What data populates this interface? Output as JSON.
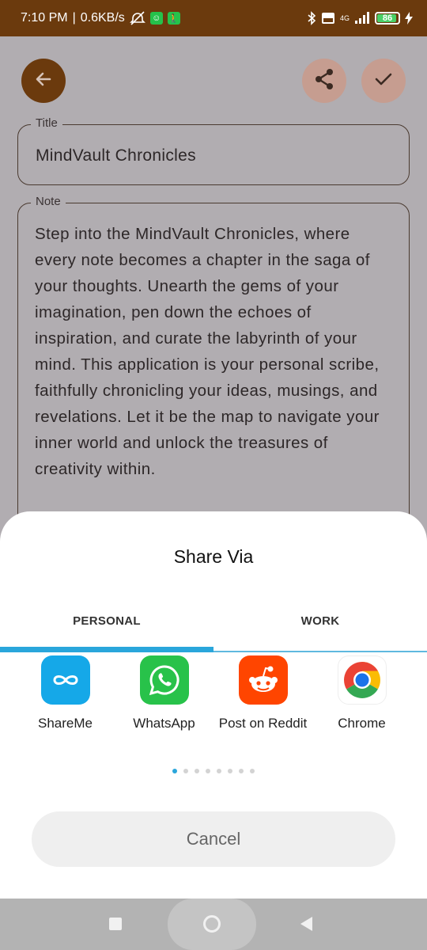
{
  "status_bar": {
    "time": "7:10 PM",
    "separator": "|",
    "speed": "0.6KB/s",
    "network": "4G",
    "battery": "86",
    "colors": {
      "background": "#6b3a0d"
    }
  },
  "toolbar": {
    "back_icon": "arrow-left-icon",
    "share_icon": "share-icon",
    "save_icon": "check-icon"
  },
  "form": {
    "title_label": "Title",
    "title_value": "MindVault Chronicles",
    "note_label": "Note",
    "note_value": "Step into the MindVault Chronicles, where every note becomes a chapter in the saga of your thoughts. Unearth the gems of your imagination, pen down the echoes of inspiration, and curate the labyrinth of your mind. This application is your personal scribe, faithfully chronicling your ideas, musings, and revelations. Let it be the map to navigate your inner world and unlock the treasures of creativity within."
  },
  "share_sheet": {
    "title": "Share Via",
    "tabs": [
      {
        "label": "PERSONAL",
        "selected": true
      },
      {
        "label": "WORK",
        "selected": false
      }
    ],
    "apps": [
      {
        "label": "ShareMe",
        "icon": "shareme-icon"
      },
      {
        "label": "WhatsApp",
        "icon": "whatsapp-icon"
      },
      {
        "label": "Post on Reddit",
        "icon": "reddit-icon"
      },
      {
        "label": "Chrome",
        "icon": "chrome-icon"
      }
    ],
    "page_count": 8,
    "current_page": 1,
    "cancel_label": "Cancel",
    "accent_color": "#2aa6db"
  }
}
